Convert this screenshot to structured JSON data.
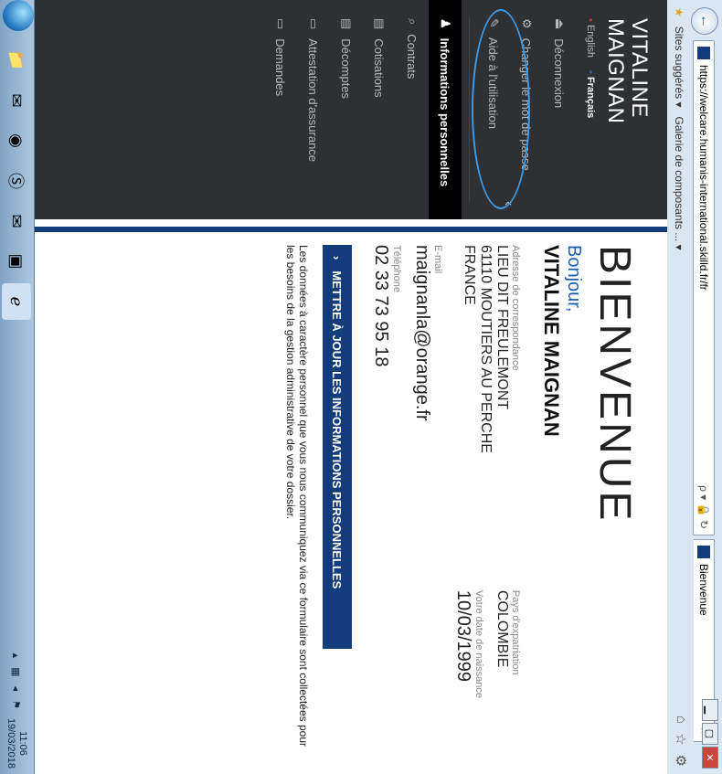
{
  "browser": {
    "url": "https://welcare.humanis-international.skilld.fr/fr",
    "tab_title": "Bienvenue",
    "tab_close": "×",
    "favorites": [
      "Sites suggérés ▾",
      "Galerie de composants ... ▾"
    ],
    "search_icons": "ρ ▾ 🔒 ↻"
  },
  "sidebar": {
    "user_first": "VITALINE",
    "user_last": "MAIGNAN",
    "lang_en": "English",
    "lang_fr": "Français",
    "items": [
      {
        "label": "Déconnexion",
        "icon": "logout-icon"
      },
      {
        "label": "Changer le mot de passe",
        "icon": "gear-icon"
      },
      {
        "label": "Aide à l'utilisation",
        "icon": "wrench-icon"
      },
      {
        "label": "Informations personnelles",
        "icon": "user-icon"
      },
      {
        "label": "Contrats",
        "icon": "search-icon"
      },
      {
        "label": "Cotisations",
        "icon": "chart-icon"
      },
      {
        "label": "Décomptes",
        "icon": "chart-icon"
      },
      {
        "label": "Attestation d'assurance",
        "icon": "document-icon"
      },
      {
        "label": "Demandes",
        "icon": "document-icon"
      }
    ]
  },
  "main": {
    "title": "BIENVENUE",
    "bonjour": "Bonjour,",
    "name": "VITALINE MAIGNAN",
    "address_label": "Adresse de correspondance",
    "address_lines": [
      "LIEU DIT FREULEMONT",
      "61110 MOUTIERS AU PERCHE",
      "FRANCE"
    ],
    "country_label": "Pays d'expatriation",
    "country": "COLOMBIE",
    "birth_label": "Votre date de naissance",
    "birth": "10/03/1999",
    "email_label": "E-mail",
    "email": "maignanla@orange.fr",
    "phone_label": "Téléphone",
    "phone": "02 33 73 95 18",
    "update_button": "METTRE À JOUR LES INFORMATIONS PERSONNELLES",
    "notice": "Les données à caractère personnel que vous nous communiquez via ce formulaire sont collectées pour les besoins de la gestion administrative de votre dossier."
  },
  "taskbar": {
    "time": "11:06",
    "date": "19/03/2018"
  },
  "colors": {
    "sidebar_bg": "#2f3033",
    "accent": "#123d7a",
    "link": "#1a5fb4",
    "highlight": "#3b9be8"
  }
}
